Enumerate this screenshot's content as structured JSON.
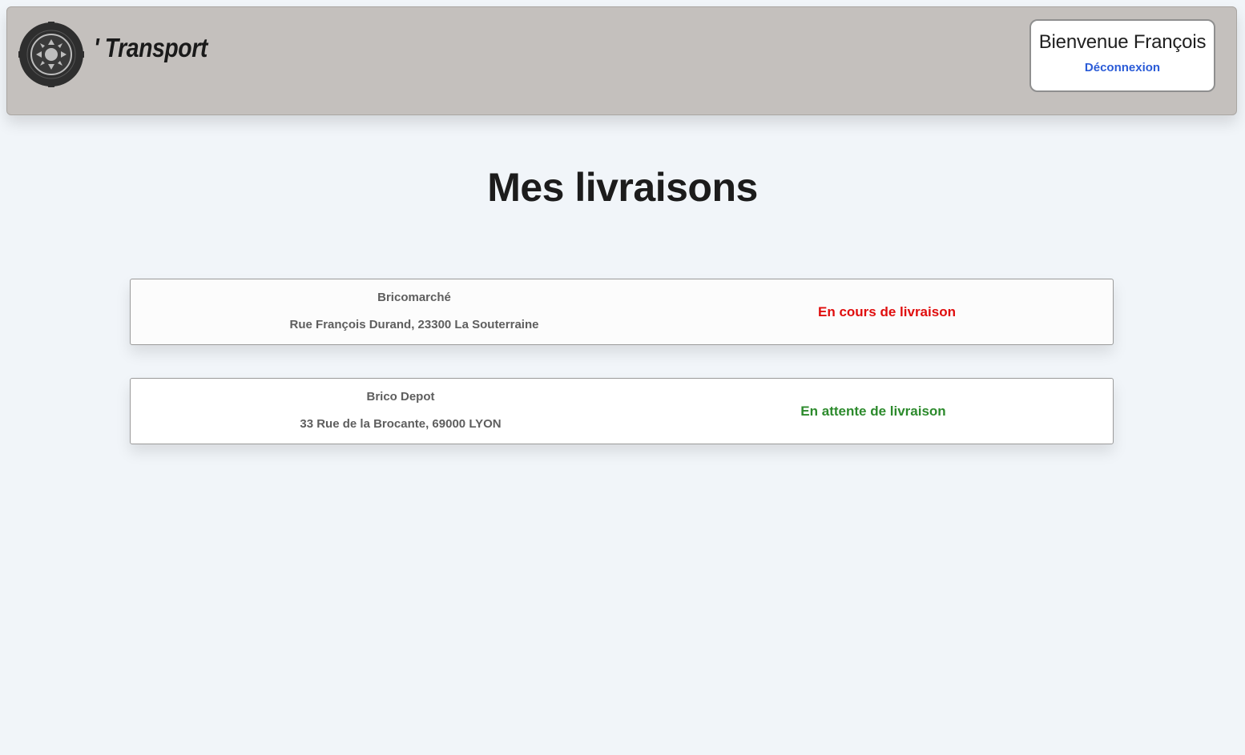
{
  "header": {
    "brand": "' Transport",
    "logo_icon": "tire-wheel-icon",
    "welcome": "Bienvenue François",
    "logout_label": "Déconnexion"
  },
  "main": {
    "title": "Mes livraisons"
  },
  "deliveries": [
    {
      "store": "Bricomarché",
      "address": "Rue François Durand, 23300 La Souterraine",
      "status": "En cours de livraison",
      "status_color": "#e00d0d"
    },
    {
      "store": "Brico Depot",
      "address": "33 Rue de la Brocante, 69000 LYON",
      "status": "En attente de livraison",
      "status_color": "#2c8a2c"
    }
  ],
  "colors": {
    "header_bg": "#c4c0bd",
    "page_bg": "#f1f5f9",
    "link": "#2a5bd7"
  }
}
